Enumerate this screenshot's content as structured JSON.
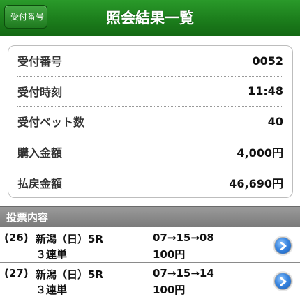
{
  "header": {
    "back_label": "受付番号",
    "title": "照会結果一覧"
  },
  "summary": {
    "rows": [
      {
        "label": "受付番号",
        "value": "0052"
      },
      {
        "label": "受付時刻",
        "value": "11:48"
      },
      {
        "label": "受付ベット数",
        "value": "40"
      },
      {
        "label": "購入金額",
        "value": "4,000円"
      },
      {
        "label": "払戻金額",
        "value": "46,690円"
      }
    ]
  },
  "section": {
    "title": "投票内容"
  },
  "votes": [
    {
      "num": "(26)",
      "race": "新潟（日）5R",
      "bet_type": "３連単",
      "combo": "07→15→08",
      "amount": "100円"
    },
    {
      "num": "(27)",
      "race": "新潟（日）5R",
      "bet_type": "３連単",
      "combo": "07→15→14",
      "amount": "100円"
    }
  ]
}
